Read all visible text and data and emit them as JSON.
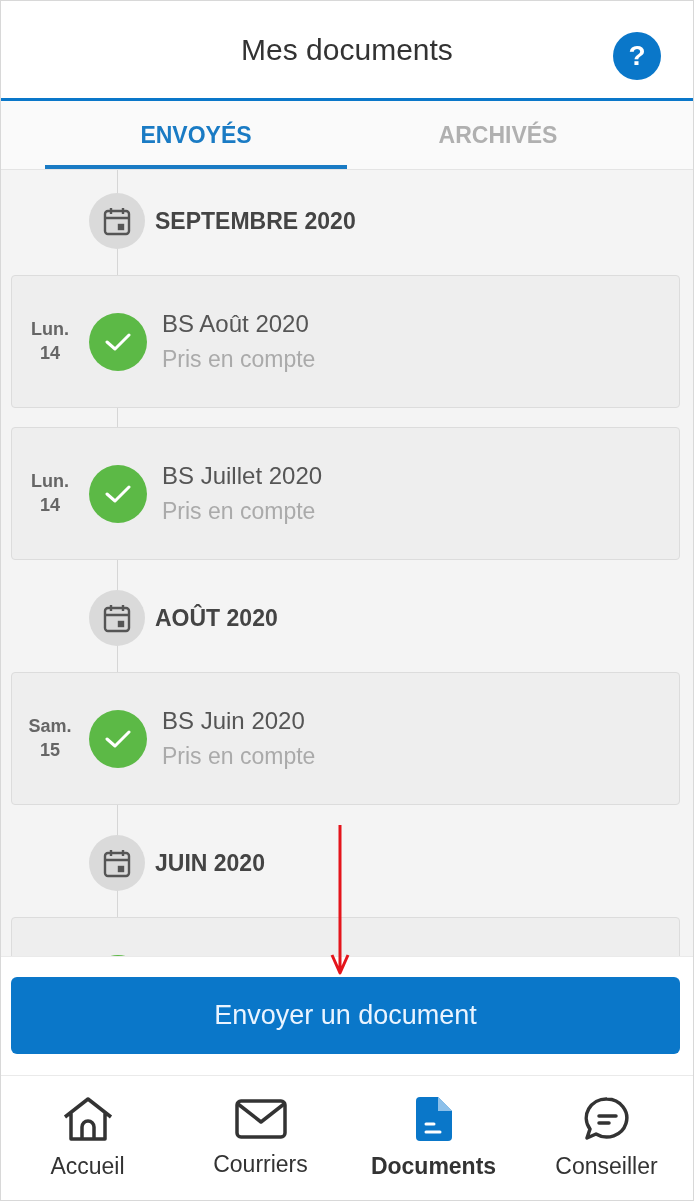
{
  "header": {
    "title": "Mes documents",
    "help_label": "?"
  },
  "tabs": [
    {
      "label": "ENVOYÉS",
      "selected": true
    },
    {
      "label": "ARCHIVÉS",
      "selected": false
    }
  ],
  "groups": [
    {
      "month": "SEPTEMBRE 2020",
      "items": [
        {
          "day": "Lun.",
          "date": "14",
          "title": "BS Août 2020",
          "status": "Pris en compte",
          "done": true
        },
        {
          "day": "Lun.",
          "date": "14",
          "title": "BS Juillet 2020",
          "status": "Pris en compte",
          "done": true
        }
      ]
    },
    {
      "month": "AOÛT 2020",
      "items": [
        {
          "day": "Sam.",
          "date": "15",
          "title": "BS Juin 2020",
          "status": "Pris en compte",
          "done": true
        }
      ]
    },
    {
      "month": "JUIN 2020",
      "items": [
        {
          "done": true
        }
      ]
    }
  ],
  "action_button": "Envoyer un document",
  "nav": [
    {
      "kind": "home",
      "label": "Accueil",
      "selected": false
    },
    {
      "kind": "mail",
      "label": "Courriers",
      "selected": false
    },
    {
      "kind": "document",
      "label": "Documents",
      "selected": true
    },
    {
      "kind": "chat",
      "label": "Conseiller",
      "selected": false
    }
  ]
}
